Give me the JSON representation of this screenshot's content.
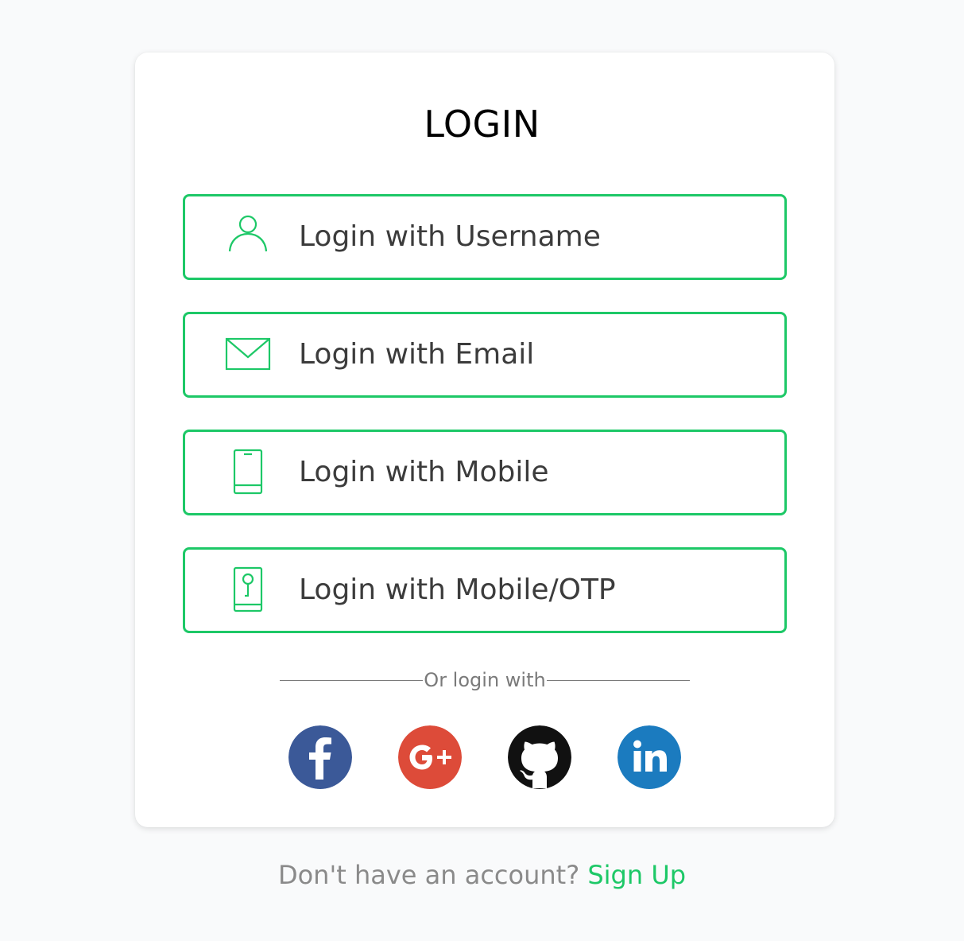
{
  "page": {
    "title": "LOGIN"
  },
  "login_options": [
    {
      "label": "Login with Username",
      "icon": "user-icon"
    },
    {
      "label": "Login with Email",
      "icon": "envelope-icon"
    },
    {
      "label": "Login with Mobile",
      "icon": "mobile-phone-icon"
    },
    {
      "label": "Login with Mobile/OTP",
      "icon": "mobile-key-icon"
    }
  ],
  "divider": {
    "text": "Or login with"
  },
  "social_logins": [
    {
      "icon": "facebook-icon",
      "color": "#3b5998"
    },
    {
      "icon": "google-plus-icon",
      "color": "#dd4b39"
    },
    {
      "icon": "github-icon",
      "color": "#111111"
    },
    {
      "icon": "linkedin-icon",
      "color": "#1b7bbf"
    }
  ],
  "footer": {
    "question": "Don't have an account?",
    "signup_label": "Sign Up"
  },
  "colors": {
    "accent": "#1dc867",
    "background": "#f9fafb",
    "card": "#ffffff",
    "button_text": "#3c3c3c",
    "muted_text": "#8a8a8a"
  }
}
